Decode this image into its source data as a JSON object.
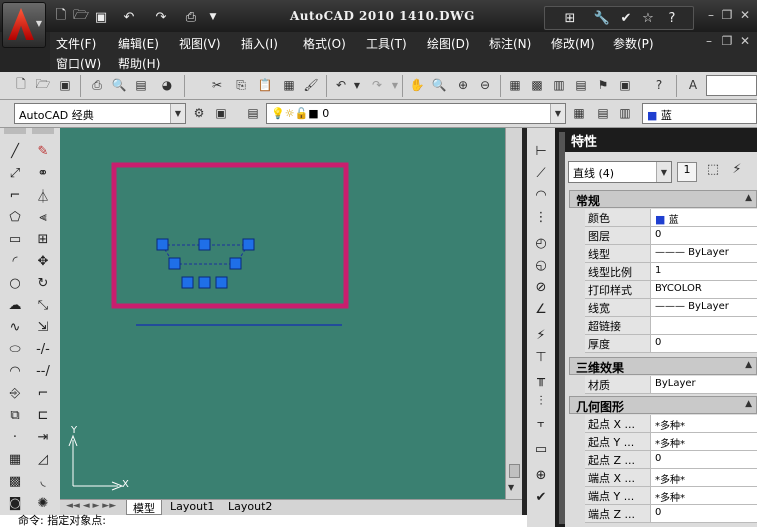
{
  "window": {
    "title": "AutoCAD 2010    1410.DWG"
  },
  "menu": {
    "row1": [
      "文件(F)",
      "编辑(E)",
      "视图(V)",
      "插入(I)",
      "格式(O)",
      "工具(T)",
      "绘图(D)",
      "标注(N)",
      "修改(M)",
      "参数(P)"
    ],
    "row2": [
      "窗口(W)",
      "帮助(H)"
    ]
  },
  "toolbar": {
    "workspace": "AutoCAD 经典",
    "layer": "0",
    "color": "蓝"
  },
  "canvas": {
    "ucs_x": "X",
    "ucs_y": "Y",
    "tabs": [
      "模型",
      "Layout1",
      "Layout2"
    ]
  },
  "command": {
    "prompt": "命令: 指定对象点:"
  },
  "properties": {
    "header": "特性",
    "selection": "直线 (4)",
    "sections": {
      "general": "常规",
      "threed": "三维效果",
      "geometry": "几何图形"
    },
    "general": [
      {
        "k": "颜色",
        "v": "蓝"
      },
      {
        "k": "图层",
        "v": "0"
      },
      {
        "k": "线型",
        "v": "——— ByLayer"
      },
      {
        "k": "线型比例",
        "v": "1"
      },
      {
        "k": "打印样式",
        "v": "BYCOLOR"
      },
      {
        "k": "线宽",
        "v": "——— ByLayer"
      },
      {
        "k": "超链接",
        "v": ""
      },
      {
        "k": "厚度",
        "v": "0"
      }
    ],
    "threed": [
      {
        "k": "材质",
        "v": "ByLayer"
      }
    ],
    "geometry": [
      {
        "k": "起点 X ...",
        "v": "*多种*"
      },
      {
        "k": "起点 Y ...",
        "v": "*多种*"
      },
      {
        "k": "起点 Z ...",
        "v": "0"
      },
      {
        "k": "端点 X ...",
        "v": "*多种*"
      },
      {
        "k": "端点 Y ...",
        "v": "*多种*"
      },
      {
        "k": "端点 Z ...",
        "v": "0"
      }
    ]
  },
  "colors": {
    "canvas": "#3a8071",
    "highlight": "#c81e6e",
    "grip": "#1f6fe8",
    "line": "#1a3aa8"
  }
}
